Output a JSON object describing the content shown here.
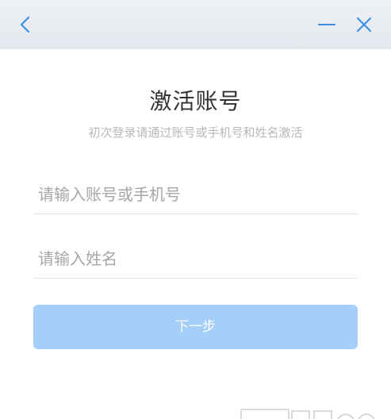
{
  "titlebar": {
    "back_icon": "chevron-left-icon",
    "minimize_icon": "minus-icon",
    "close_icon": "close-icon",
    "icon_color": "#3a8ee6"
  },
  "header": {
    "title": "激活账号",
    "subtitle": "初次登录请通过账号或手机号和姓名激活"
  },
  "form": {
    "account_placeholder": "请输入账号或手机号",
    "account_value": "",
    "name_placeholder": "请输入姓名",
    "name_value": "",
    "next_label": "下一步"
  },
  "colors": {
    "button_bg": "#a5cff8",
    "title_text": "#333333",
    "subtitle_text": "#b8b8b8"
  }
}
